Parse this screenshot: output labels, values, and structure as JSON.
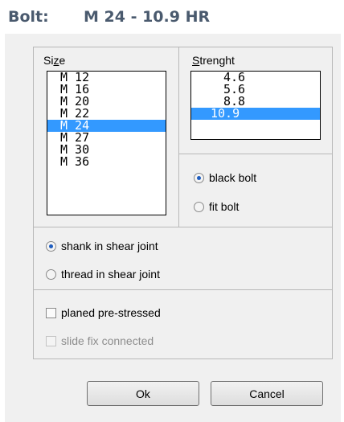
{
  "header": {
    "label": "Bolt:",
    "value": "M 24 - 10.9 HR"
  },
  "size_group": {
    "label_pre": "Si",
    "label_accel": "z",
    "label_post": "e",
    "items": [
      "M 12",
      "M 16",
      "M 20",
      "M 22",
      "M 24",
      "M 27",
      "M 30",
      "M 36"
    ],
    "selected": "M 24"
  },
  "strength_group": {
    "label_accel": "S",
    "label_post": "trenght",
    "items": [
      "4.6",
      "5.6",
      "8.8",
      "10.9"
    ],
    "selected": "10.9"
  },
  "bolt_type": {
    "options": [
      "black bolt",
      "fit bolt"
    ],
    "selected": "black bolt"
  },
  "joint": {
    "options": [
      "shank in shear joint",
      "thread in shear joint"
    ],
    "selected": "shank in shear joint"
  },
  "checks": {
    "planed": {
      "label": "planed pre-stressed",
      "checked": false,
      "enabled": true
    },
    "slide": {
      "label": "slide fix connected",
      "checked": false,
      "enabled": false
    }
  },
  "buttons": {
    "ok": "Ok",
    "cancel": "Cancel"
  },
  "colors": {
    "selection": "#3399ff",
    "title_text": "#4a5a6e",
    "dialog_bg": "#f0f0f0"
  }
}
